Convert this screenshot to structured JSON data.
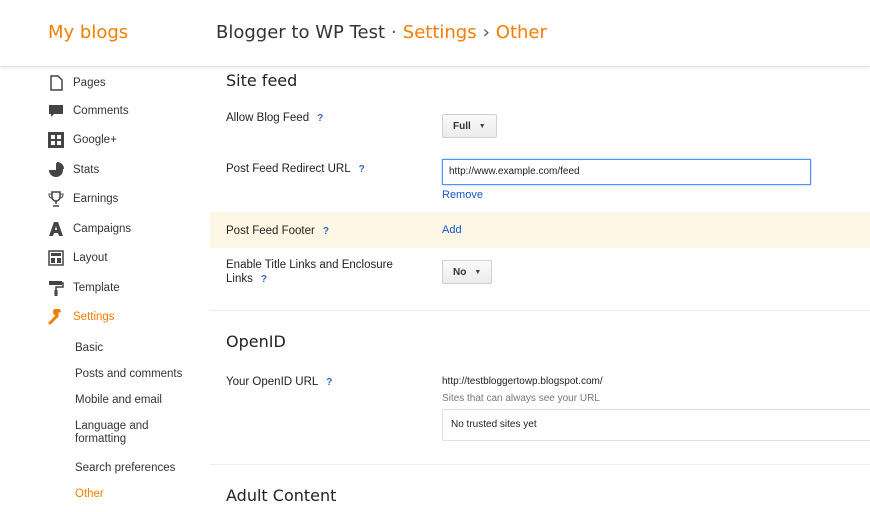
{
  "header": {
    "logo": "My blogs",
    "blog_name": "Blogger to WP Test",
    "sep1": "·",
    "crumb_settings": "Settings",
    "sep2": "›",
    "crumb_other": "Other"
  },
  "sidebar": {
    "items": [
      {
        "label": "Pages",
        "icon": "page-icon"
      },
      {
        "label": "Comments",
        "icon": "comment-icon"
      },
      {
        "label": "Google+",
        "icon": "google-plus-icon"
      },
      {
        "label": "Stats",
        "icon": "pie-chart-icon"
      },
      {
        "label": "Earnings",
        "icon": "trophy-icon"
      },
      {
        "label": "Campaigns",
        "icon": "campaigns-icon"
      },
      {
        "label": "Layout",
        "icon": "layout-icon"
      },
      {
        "label": "Template",
        "icon": "paint-roller-icon"
      },
      {
        "label": "Settings",
        "icon": "wrench-icon"
      }
    ],
    "subitems": [
      {
        "label": "Basic"
      },
      {
        "label": "Posts and comments"
      },
      {
        "label": "Mobile and email"
      },
      {
        "label": "Language and formatting"
      },
      {
        "label": "Search preferences"
      },
      {
        "label": "Other"
      }
    ],
    "active_color": "#f57d00"
  },
  "main": {
    "site_feed": {
      "title": "Site feed",
      "allow_blog_feed_label": "Allow Blog Feed",
      "allow_blog_feed_value": "Full",
      "redirect_label": "Post Feed Redirect URL",
      "redirect_value": "http://www.example.com/feed",
      "remove_link": "Remove",
      "footer_label": "Post Feed Footer",
      "footer_link": "Add",
      "title_links_label": "Enable Title Links and Enclosure Links",
      "title_links_value": "No",
      "help": "?"
    },
    "openid": {
      "title": "OpenID",
      "url_label": "Your OpenID URL",
      "url_value": "http://testbloggertowp.blogspot.com/",
      "note": "Sites that can always see your URL",
      "trusted": "No trusted sites yet"
    },
    "adult": {
      "title": "Adult Content"
    }
  },
  "colors": {
    "accent": "#f57d00",
    "link": "#1155cc",
    "highlight": "#fff7e6"
  }
}
